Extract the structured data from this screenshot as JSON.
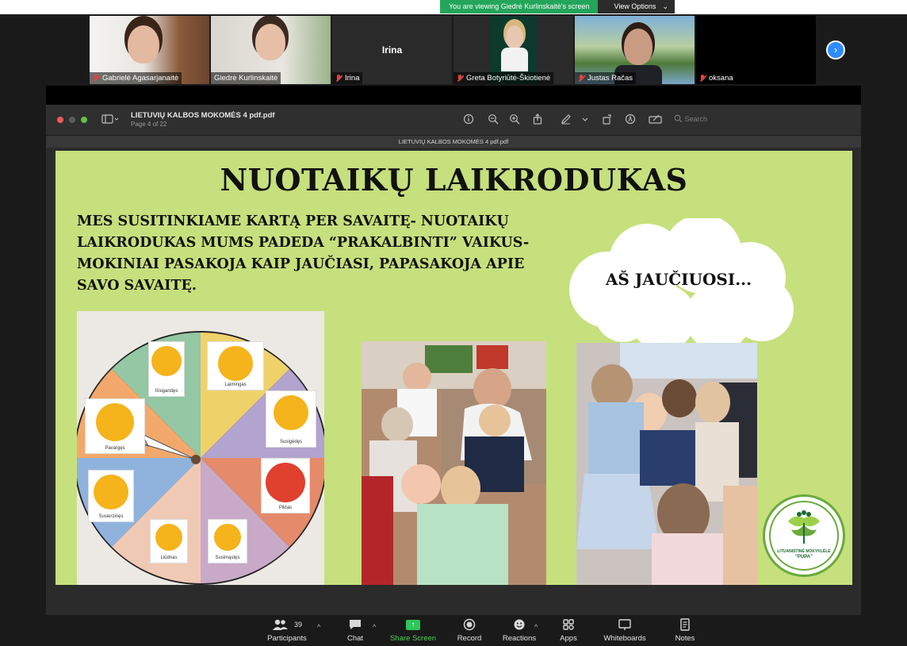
{
  "banner": {
    "viewing_text": "You are viewing Giedrė Kurlinskaitė's screen",
    "view_options": "View Options",
    "chevron": "⌄"
  },
  "participants": [
    {
      "name": "Gabrielė Agasarjanaitė",
      "muted": true
    },
    {
      "name": "Giedrė Kurlinskaitė",
      "muted": false
    },
    {
      "name": "Irina",
      "muted": true,
      "center_label": "Irina"
    },
    {
      "name": "Greta Botyriūtė-Škiotienė",
      "muted": true
    },
    {
      "name": "Justas Račas",
      "muted": true
    },
    {
      "name": "oksana",
      "muted": true
    }
  ],
  "next_page": "›",
  "pdf": {
    "file_title": "LIETUVIŲ KALBOS MOKOMĖS 4 pdf.pdf",
    "page_info": "Page 4 of 22",
    "tab_title": "LIETUVIŲ KALBOS MOKOMĖS 4 pdf.pdf",
    "search_placeholder": "Search"
  },
  "slide": {
    "title": "NUOTAIKŲ LAIKRODUKAS",
    "body": "MES SUSITINKIAME KARTĄ PER SAVAITĘ- NUOTAIKŲ LAIKRODUKAS MUMS PADEDA “PRAKALBINTI” VAIKUS- MOKINIAI PASAKOJA KAIP JAUČIASI, PAPASAKOJA APIE SAVO SAVAITĘ.",
    "cloud_text": "AŠ JAUČIUOSI...",
    "emotions": [
      "Išsigandęs",
      "Laimingas",
      "Susigėdęs",
      "Piktas",
      "Susimąstęs",
      "Liūdnas",
      "Susierzinęs",
      "Pavargęs"
    ],
    "logo_line1": "LITUANISTINĖ MOKYKLĖLĖ",
    "logo_line2": "\"PUPA\""
  },
  "bottom_bar": {
    "participants_label": "Participants",
    "participants_count": "39",
    "chat_label": "Chat",
    "share_label": "Share Screen",
    "record_label": "Record",
    "reactions_label": "Reactions",
    "apps_label": "Apps",
    "whiteboards_label": "Whiteboards",
    "notes_label": "Notes"
  },
  "colors": {
    "slide_bg": "#c6e07d",
    "zoom_green": "#23a55a",
    "zoom_blue": "#2d8cff",
    "mute_red": "#e0453e"
  }
}
